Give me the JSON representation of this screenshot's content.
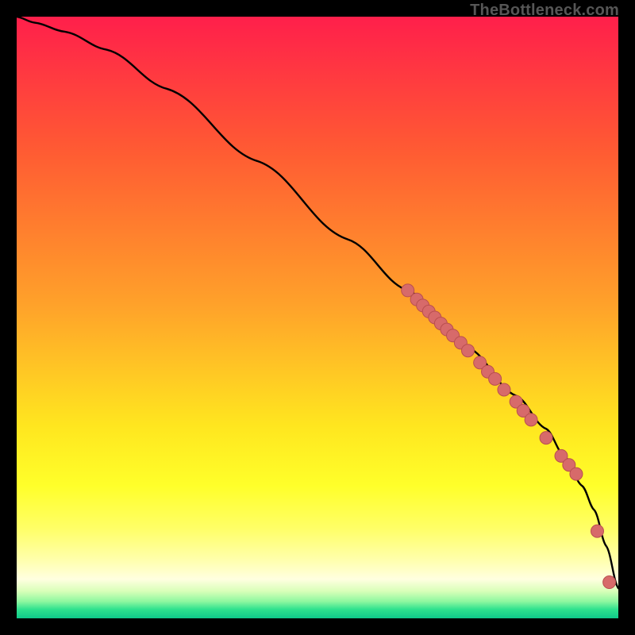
{
  "attribution": "TheBottleneck.com",
  "colors": {
    "bg": "#000000",
    "gradient_stops": [
      {
        "offset": 0.0,
        "color": "#ff1f4b"
      },
      {
        "offset": 0.1,
        "color": "#ff3a40"
      },
      {
        "offset": 0.22,
        "color": "#ff5a33"
      },
      {
        "offset": 0.35,
        "color": "#ff7e2e"
      },
      {
        "offset": 0.48,
        "color": "#ffa22a"
      },
      {
        "offset": 0.58,
        "color": "#ffc425"
      },
      {
        "offset": 0.68,
        "color": "#ffe61f"
      },
      {
        "offset": 0.78,
        "color": "#ffff2a"
      },
      {
        "offset": 0.85,
        "color": "#ffff66"
      },
      {
        "offset": 0.9,
        "color": "#ffffa8"
      },
      {
        "offset": 0.935,
        "color": "#ffffe0"
      },
      {
        "offset": 0.955,
        "color": "#d8ffb8"
      },
      {
        "offset": 0.972,
        "color": "#8ef7a0"
      },
      {
        "offset": 0.985,
        "color": "#2fe28e"
      },
      {
        "offset": 1.0,
        "color": "#0fc98a"
      }
    ],
    "curve": "#000000",
    "marker_fill": "#d76a6a",
    "marker_stroke": "#b94f4f",
    "attrib_text": "#565656"
  },
  "chart_data": {
    "type": "line",
    "x": [
      0,
      3,
      8,
      15,
      25,
      40,
      55,
      65,
      75,
      83,
      88,
      91,
      94,
      96,
      98,
      100
    ],
    "values": [
      100,
      99,
      97.5,
      94.5,
      88,
      76,
      63,
      54.5,
      45,
      37,
      31.5,
      27,
      22,
      18,
      12,
      5
    ],
    "xlim": [
      0,
      100
    ],
    "ylim": [
      0,
      100
    ],
    "series": [
      {
        "name": "marker-cluster",
        "type": "scatter",
        "x": [
          65,
          66.5,
          67.5,
          68.5,
          69.5,
          70.5,
          71.5,
          72.5,
          73.8,
          75,
          77,
          78.3,
          79.5,
          81,
          83,
          84.2,
          85.5,
          88,
          90.5,
          91.8,
          93,
          96.5,
          98.5
        ],
        "values": [
          54.5,
          53,
          52,
          51,
          50,
          49,
          48,
          47,
          45.8,
          44.5,
          42.5,
          41,
          39.8,
          38,
          36,
          34.5,
          33,
          30,
          27,
          25.5,
          24,
          14.5,
          6
        ]
      }
    ],
    "title": "",
    "xlabel": "",
    "ylabel": "",
    "grid": false,
    "legend": false
  }
}
